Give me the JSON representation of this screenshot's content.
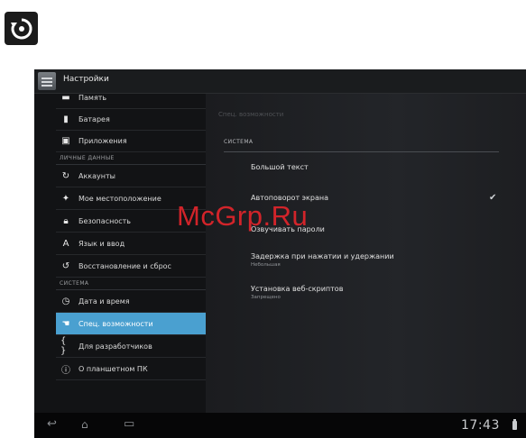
{
  "watermark": "McGrp.Ru",
  "app": {
    "title": "Настройки"
  },
  "left_menu": {
    "items_top": [
      {
        "label": "Память",
        "icon": "storage-icon"
      },
      {
        "label": "Батарея",
        "icon": "battery-icon"
      },
      {
        "label": "Приложения",
        "icon": "apps-icon"
      }
    ],
    "section_personal": "ЛИЧНЫЕ ДАННЫЕ",
    "items_personal": [
      {
        "label": "Аккаунты",
        "icon": "sync-icon"
      },
      {
        "label": "Мое местоположение",
        "icon": "location-icon"
      },
      {
        "label": "Безопасность",
        "icon": "lock-icon"
      },
      {
        "label": "Язык и ввод",
        "icon": "language-icon"
      },
      {
        "label": "Восстановление и сброс",
        "icon": "restore-icon"
      }
    ],
    "section_system": "СИСТЕМА",
    "items_system": [
      {
        "label": "Дата и время",
        "icon": "clock-icon"
      },
      {
        "label": "Спец. возможности",
        "icon": "hand-icon",
        "selected": true
      },
      {
        "label": "Для разработчиков",
        "icon": "braces-icon"
      },
      {
        "label": "О планшетном ПК",
        "icon": "info-icon"
      }
    ]
  },
  "right_panel": {
    "header": "Спец. возможности",
    "section": "СИСТЕМА",
    "items": [
      {
        "title": "Большой текст"
      },
      {
        "title": "Автоповорот экрана",
        "checked": true
      },
      {
        "title": "Озвучивать пароли"
      },
      {
        "title": "Задержка при нажатии и удержании",
        "sub": "Небольшая"
      },
      {
        "title": "Установка веб-скриптов",
        "sub": "Запрещено"
      }
    ]
  },
  "status": {
    "time": "17:43"
  },
  "navbar": {
    "back": "back-icon",
    "home": "home-icon",
    "recents": "recents-icon"
  },
  "colors": {
    "selected": "#4aa0d0",
    "watermark": "#e2252b",
    "background": "#0e0e10"
  }
}
